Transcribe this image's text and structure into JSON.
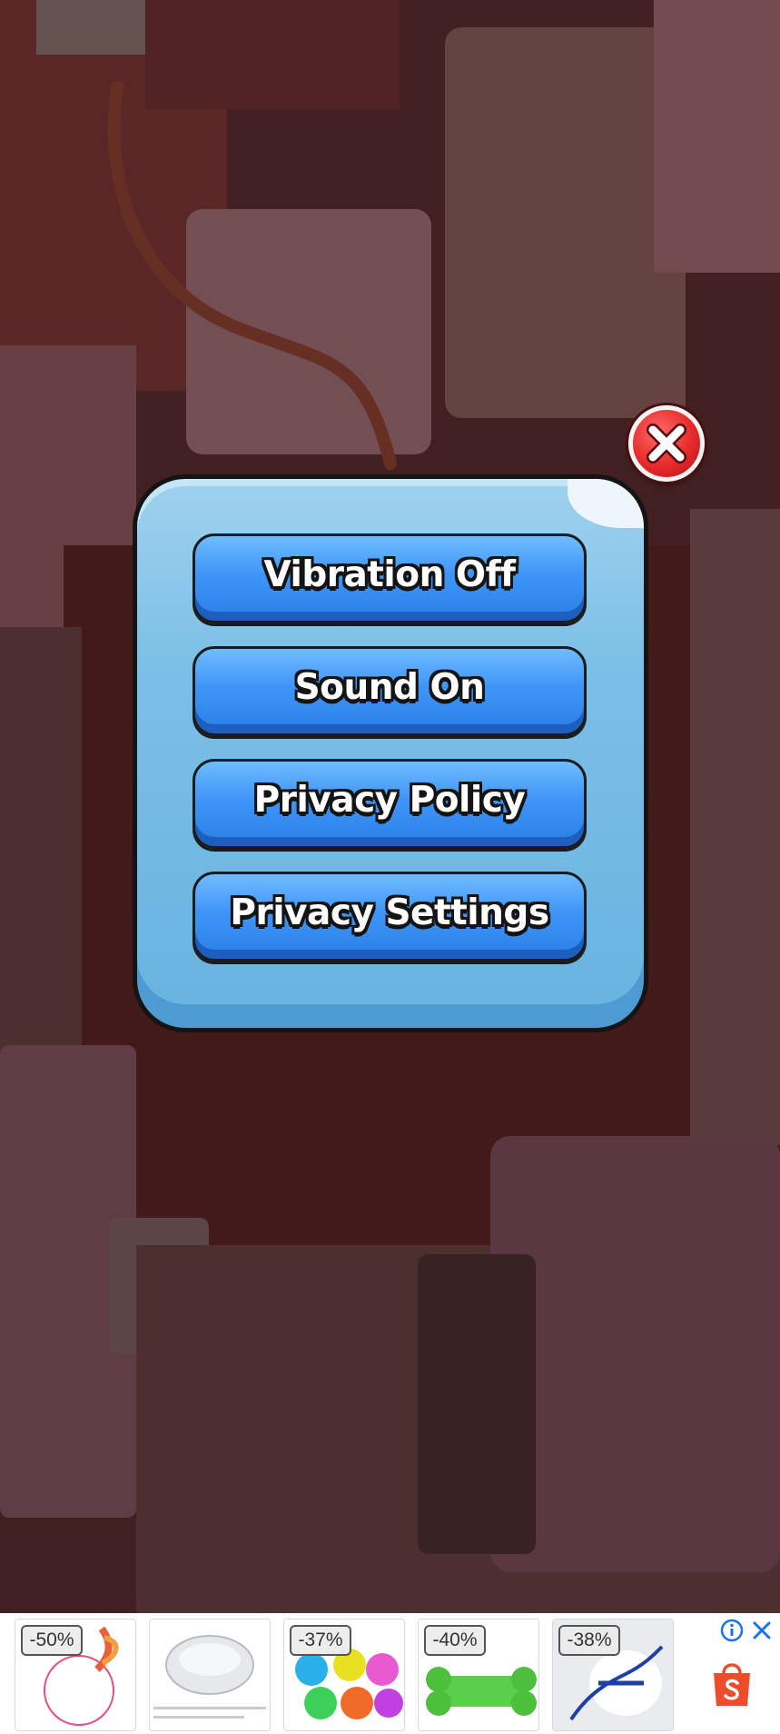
{
  "menu": {
    "vibration_label": "Vibration Off",
    "sound_label": "Sound On",
    "privacy_policy_label": "Privacy Policy",
    "privacy_settings_label": "Privacy Settings"
  },
  "close_icon": "close-x-icon",
  "ad": {
    "items": [
      {
        "discount": "-50%",
        "product_icon": "cat-feather-toy"
      },
      {
        "discount": "",
        "product_icon": "pet-bowl"
      },
      {
        "discount": "-37%",
        "product_icon": "spiky-balls"
      },
      {
        "discount": "-40%",
        "product_icon": "dog-chew-bone"
      },
      {
        "discount": "-38%",
        "product_icon": "pet-harness"
      }
    ],
    "info_icon": "info-icon",
    "close_icon": "close-icon",
    "brand_icon": "shopee-bag-icon"
  },
  "colors": {
    "panel": "#7bbfe6",
    "button": "#3f95f7",
    "close": "#e82a2a",
    "ad_accent": "#1a73e8",
    "shop_brand": "#ee4d2d"
  }
}
